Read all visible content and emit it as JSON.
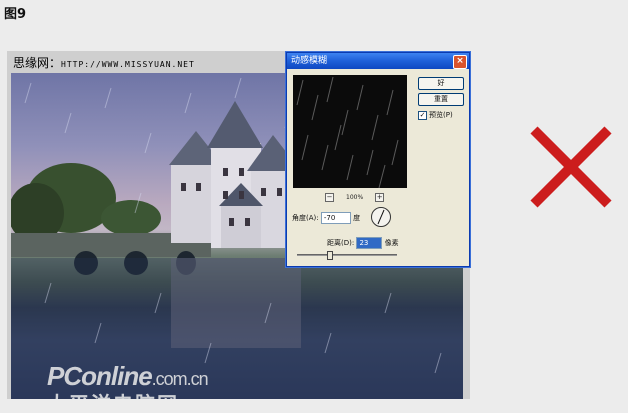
{
  "figure_label": "图9",
  "watermark_top": {
    "cn": "思缘网：",
    "url": "HTTP://WWW.MISSYUAN.NET"
  },
  "watermark_bottom": {
    "brand": "PConline",
    "domain": ".com.cn",
    "cn": "太平洋电脑网"
  },
  "dialog": {
    "title": "动感模糊",
    "close_symbol": "×",
    "ok_label": "好",
    "reset_label": "重置",
    "preview_label": "预览(P)",
    "preview_checked": true,
    "zoom": {
      "minus": "−",
      "value": "100%",
      "plus": "+"
    },
    "angle_label": "角度(A):",
    "angle_value": "-70",
    "angle_unit": "度",
    "distance_label": "距离(D):",
    "distance_value": "23",
    "distance_unit": "像素"
  },
  "verdict_mark": {
    "icon": "red-cross-icon",
    "color": "#cc1d1d"
  }
}
